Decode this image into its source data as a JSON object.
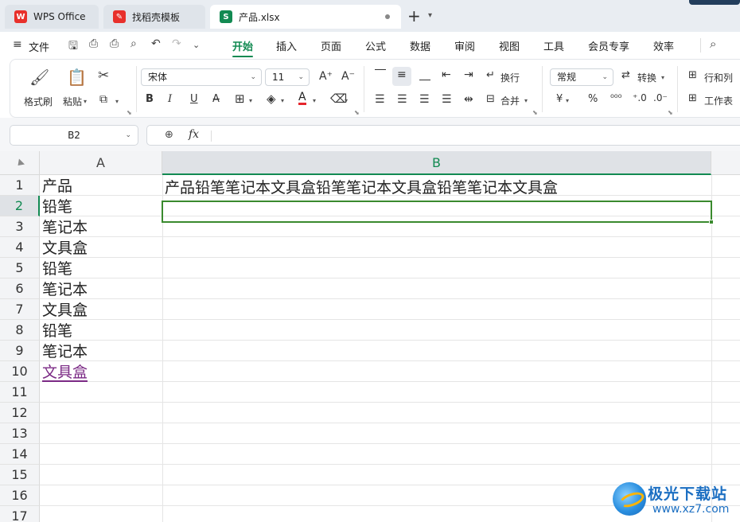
{
  "tabs": [
    {
      "label": "WPS Office",
      "icon": "wps-logo-icon",
      "color": "#e8302b"
    },
    {
      "label": "找稻壳模板",
      "icon": "docer-icon",
      "color": "#e8302b"
    },
    {
      "label": "产品.xlsx",
      "icon": "spreadsheet-s-icon",
      "icon_text": "S",
      "color": "#128a52"
    }
  ],
  "menubar": {
    "file_label": "文件",
    "items": [
      "开始",
      "插入",
      "页面",
      "公式",
      "数据",
      "审阅",
      "视图",
      "工具",
      "会员专享",
      "效率"
    ],
    "active": "开始"
  },
  "ribbon": {
    "format_painter": "格式刷",
    "paste": "粘贴",
    "font_name": "宋体",
    "font_size": "11",
    "bold": "B",
    "italic": "I",
    "underline": "U",
    "wrap_text": "换行",
    "merge": "合并",
    "number_format": "常规",
    "convert": "转换",
    "rows_cols": "行和列",
    "worksheet": "工作表",
    "currency_symbol": "¥",
    "percent_symbol": "%"
  },
  "formula_bar": {
    "name_box": "B2",
    "fx": "fx",
    "content": ""
  },
  "sheet": {
    "columns": [
      "A",
      "B"
    ],
    "rows": [
      "1",
      "2",
      "3",
      "4",
      "5",
      "6",
      "7",
      "8",
      "9",
      "10",
      "11",
      "12",
      "13",
      "14",
      "15",
      "16",
      "17"
    ],
    "colA": [
      "产品",
      "铅笔",
      "笔记本",
      "文具盒",
      "铅笔",
      "笔记本",
      "文具盒",
      "铅笔",
      "笔记本",
      "文具盒"
    ],
    "B1": "产品铅笔笔记本文具盒铅笔笔记本文具盒铅笔笔记本文具盒",
    "selected_cell": "B2"
  },
  "watermark": {
    "title": "极光下载站",
    "url": "www.xz7.com"
  },
  "colors": {
    "accent": "#128a52",
    "selection": "#3a8a2e",
    "link": "#7b2a85"
  }
}
